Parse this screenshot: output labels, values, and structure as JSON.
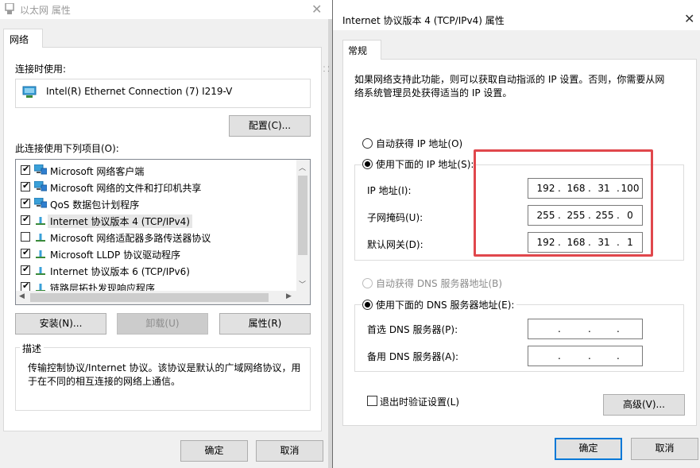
{
  "left_window": {
    "title": "以太网 属性",
    "tab": "网络",
    "connect_using_label": "连接时使用:",
    "adapter_name": "Intel(R) Ethernet Connection (7) I219-V",
    "configure_button": "配置(C)...",
    "items_label": "此连接使用下列项目(O):",
    "items": [
      {
        "label": "Microsoft 网络客户端",
        "checked": true,
        "icon": "network-client-icon"
      },
      {
        "label": "Microsoft 网络的文件和打印机共享",
        "checked": true,
        "icon": "network-share-icon"
      },
      {
        "label": "QoS 数据包计划程序",
        "checked": true,
        "icon": "qos-icon"
      },
      {
        "label": "Internet 协议版本 4 (TCP/IPv4)",
        "checked": true,
        "icon": "protocol-icon"
      },
      {
        "label": "Microsoft 网络适配器多路传送器协议",
        "checked": false,
        "icon": "protocol-icon"
      },
      {
        "label": "Microsoft LLDP 协议驱动程序",
        "checked": true,
        "icon": "protocol-icon"
      },
      {
        "label": "Internet 协议版本 6 (TCP/IPv6)",
        "checked": true,
        "icon": "protocol-icon"
      },
      {
        "label": "链路层拓扑发现响应程序",
        "checked": true,
        "icon": "protocol-icon"
      }
    ],
    "install_button": "安装(N)...",
    "uninstall_button": "卸载(U)",
    "properties_button": "属性(R)",
    "description_title": "描述",
    "description_text": "传输控制协议/Internet 协议。该协议是默认的广域网络协议，用于在不同的相互连接的网络上通信。",
    "ok_button": "确定",
    "cancel_button": "取消"
  },
  "right_window": {
    "title": "Internet 协议版本 4 (TCP/IPv4) 属性",
    "tab": "常规",
    "intro_text": "如果网络支持此功能，则可以获取自动指派的 IP 设置。否则，你需要从网络系统管理员处获得适当的 IP 设置。",
    "auto_ip_radio": "自动获得 IP 地址(O)",
    "manual_ip_radio": "使用下面的 IP 地址(S):",
    "ip_address_label": "IP 地址(I):",
    "subnet_mask_label": "子网掩码(U):",
    "gateway_label": "默认网关(D):",
    "ip_address": [
      "192",
      "168",
      "31",
      "100"
    ],
    "subnet_mask": [
      "255",
      "255",
      "255",
      "0"
    ],
    "gateway": [
      "192",
      "168",
      "31",
      "1"
    ],
    "auto_dns_radio": "自动获得 DNS 服务器地址(B)",
    "manual_dns_radio": "使用下面的 DNS 服务器地址(E):",
    "preferred_dns_label": "首选 DNS 服务器(P):",
    "alternate_dns_label": "备用 DNS 服务器(A):",
    "preferred_dns": [
      "",
      "",
      "",
      ""
    ],
    "alternate_dns": [
      "",
      "",
      "",
      ""
    ],
    "dot": ".",
    "validate_checkbox": "退出时验证设置(L)",
    "advanced_button": "高级(V)...",
    "ok_button": "确定",
    "cancel_button": "取消"
  },
  "colors": {
    "highlight_rect": "#e0474c",
    "default_button_border": "#0078d7"
  }
}
